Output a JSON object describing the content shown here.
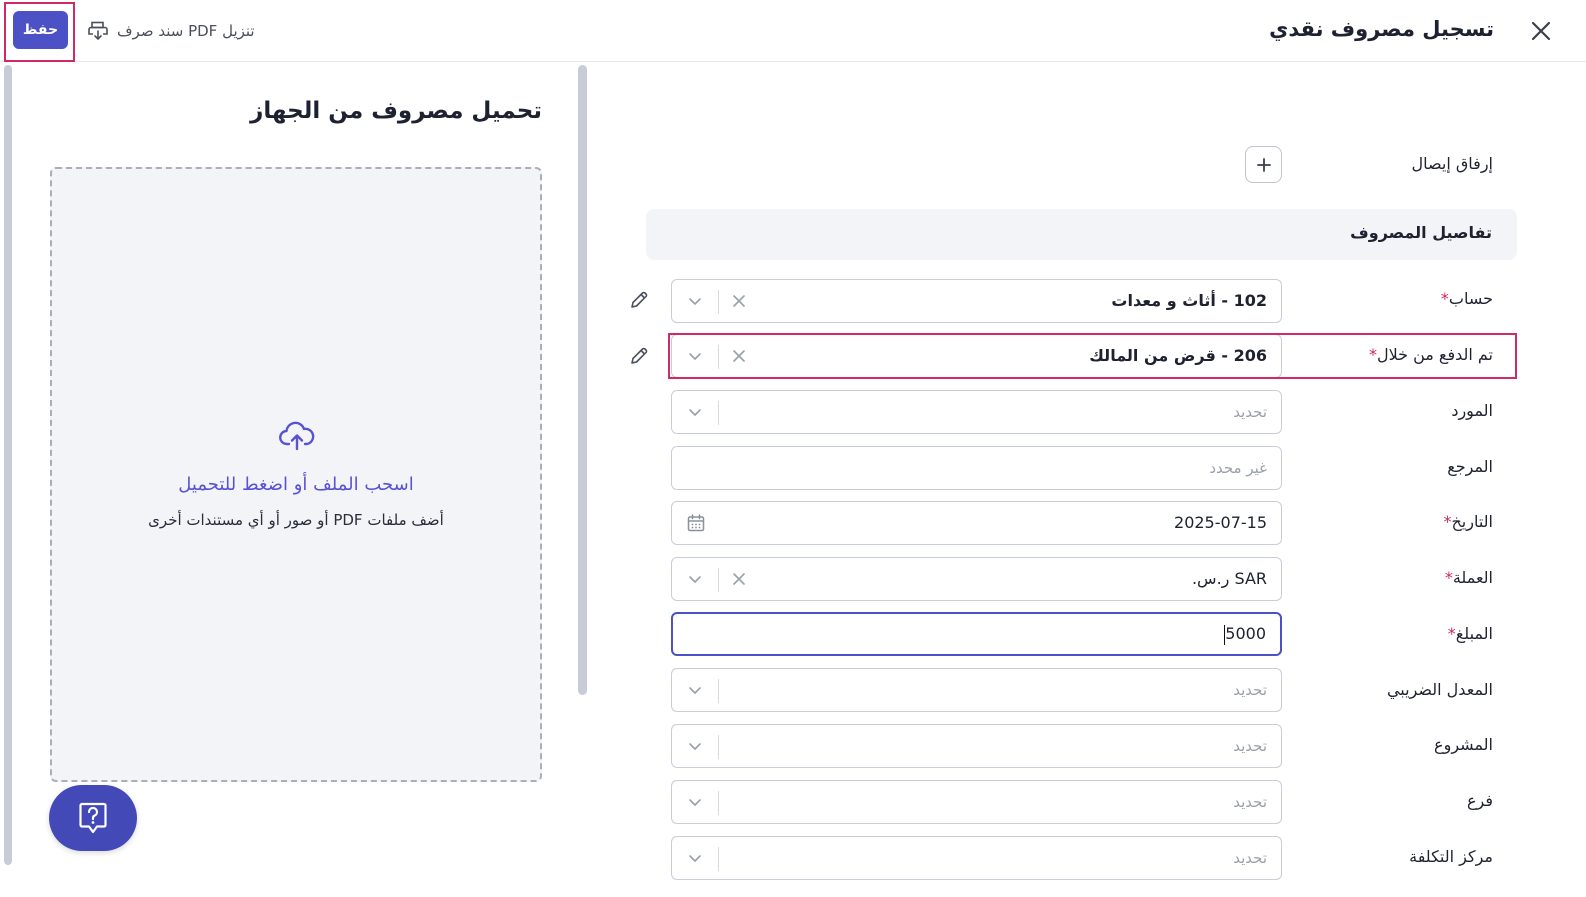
{
  "header": {
    "title": "تسجيل مصروف نقدي",
    "save_label": "حفظ",
    "download_label": "تنزيل PDF سند صرف"
  },
  "upload": {
    "title": "تحميل مصروف من الجهاز",
    "primary_text": "اسحب الملف أو اضغط للتحميل",
    "secondary_text": "أضف ملفات PDF أو صور أو أي مستندات أخرى"
  },
  "form": {
    "attach_label": "إرفاق إيصال",
    "section_title": "تفاصيل المصروف",
    "fields": {
      "account": {
        "label": "حساب",
        "value": "102 - أثاث و معدات",
        "required": true
      },
      "paid_through": {
        "label": "تم الدفع من خلال",
        "value": "206 - قرض من المالك",
        "required": true
      },
      "vendor": {
        "label": "المورد",
        "placeholder": "تحديد"
      },
      "reference": {
        "label": "المرجع",
        "placeholder": "غير محدد"
      },
      "date": {
        "label": "التاريخ",
        "value": "2025-07-15",
        "required": true
      },
      "currency": {
        "label": "العملة",
        "value": "SAR ر.س.",
        "required": true
      },
      "amount": {
        "label": "المبلغ",
        "value": "5000",
        "required": true
      },
      "tax_rate": {
        "label": "المعدل الضريبي",
        "placeholder": "تحديد"
      },
      "project": {
        "label": "المشروع",
        "placeholder": "تحديد"
      },
      "branch": {
        "label": "فرع",
        "placeholder": "تحديد"
      },
      "cost_center": {
        "label": "مركز التكلفة",
        "placeholder": "تحديد"
      }
    }
  },
  "colors": {
    "primary": "#4c51c6",
    "highlight": "#cf2a63",
    "required": "#d0245e",
    "link": "#5a52d5"
  },
  "icons": [
    "close-icon",
    "printer-download-icon",
    "cloud-upload-icon",
    "help-icon",
    "plus-icon",
    "pencil-icon",
    "chevron-down-icon",
    "clear-icon",
    "calendar-icon"
  ]
}
